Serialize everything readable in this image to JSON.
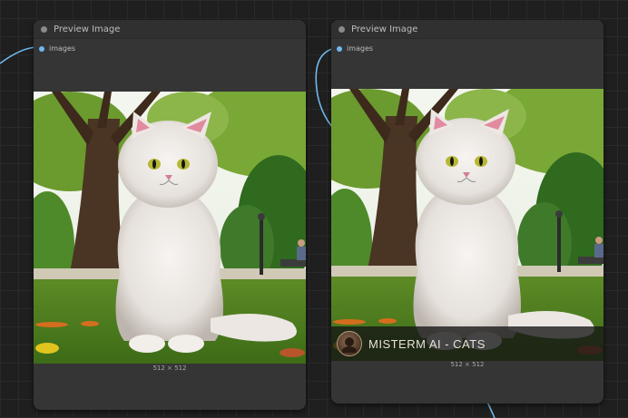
{
  "nodes": [
    {
      "title": "Preview Image",
      "input_label": "images",
      "image_alt": "White fluffy cat sitting on grass in a park",
      "dimensions": "512 × 512"
    },
    {
      "title": "Preview Image",
      "input_label": "images",
      "image_alt": "White fluffy cat sitting on grass in a park",
      "dimensions": "512 × 512",
      "watermark": "MISTERM AI - CATS"
    }
  ],
  "colors": {
    "canvas_bg": "#1f1f1f",
    "node_bg": "#353535",
    "wire": "#6fb9ee"
  }
}
